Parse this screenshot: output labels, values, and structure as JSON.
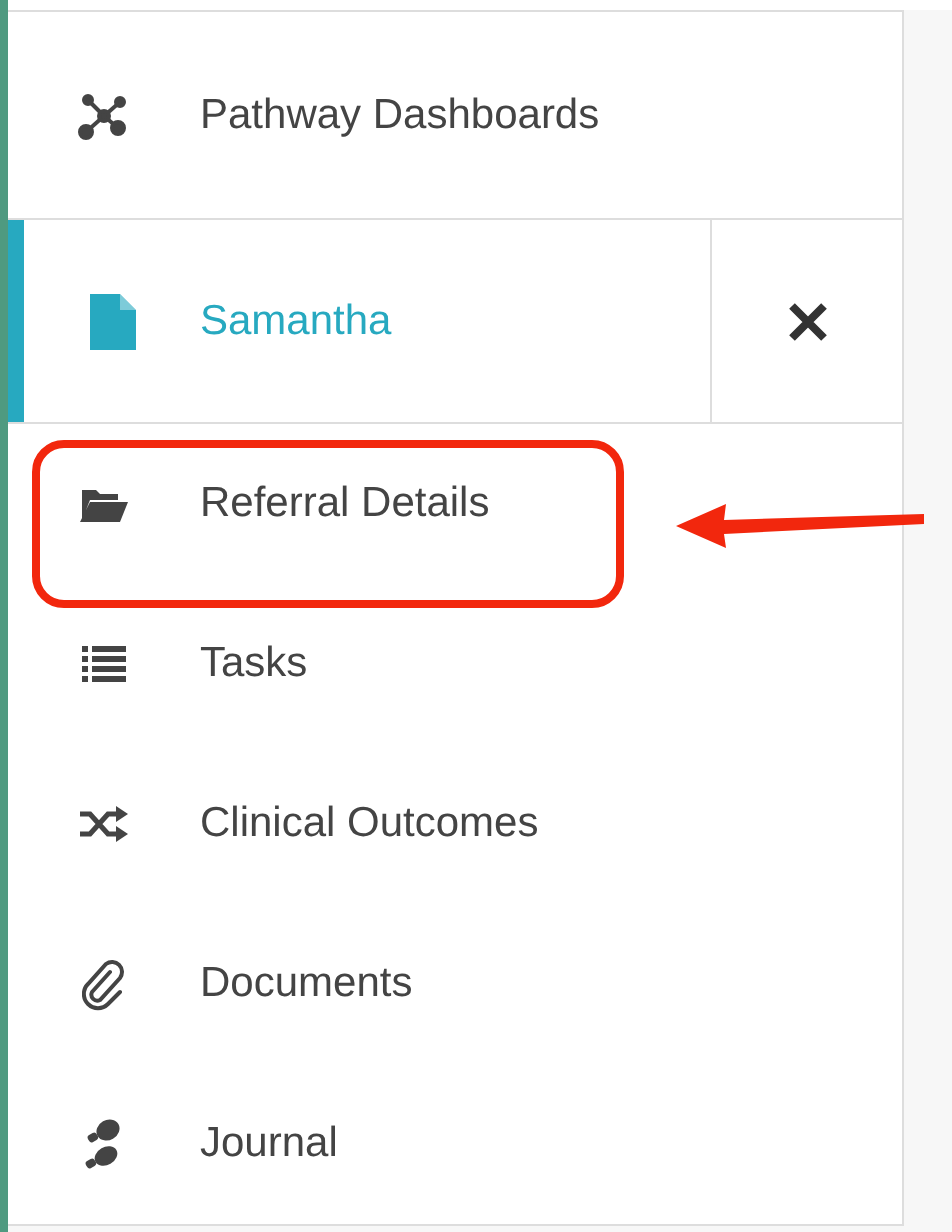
{
  "header_link": {
    "label": "Pathway Dashboards"
  },
  "patient_tab": {
    "label": "Samantha",
    "selected": true
  },
  "menu_items": [
    {
      "label": "Referral Details",
      "highlighted": true
    },
    {
      "label": "Tasks",
      "highlighted": false
    },
    {
      "label": "Clinical Outcomes",
      "highlighted": false
    },
    {
      "label": "Documents",
      "highlighted": false
    },
    {
      "label": "Journal",
      "highlighted": false
    }
  ]
}
